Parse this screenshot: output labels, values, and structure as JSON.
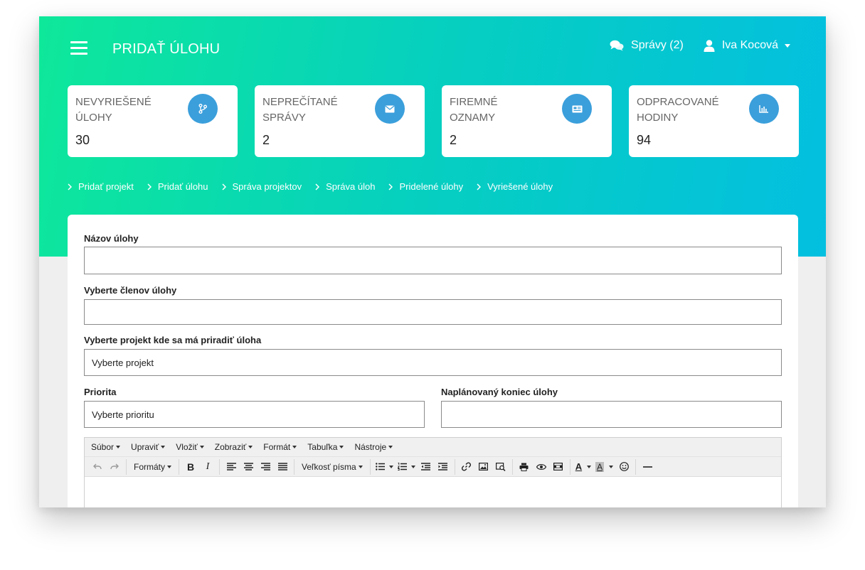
{
  "header": {
    "title": "PRIDAŤ ÚLOHU",
    "messages_label": "Správy (2)",
    "user_name": "Iva Kocová"
  },
  "stats": [
    {
      "label": "NEVYRIEŠENÉ ÚLOHY",
      "value": "30",
      "icon": "branch-icon"
    },
    {
      "label": "NEPREČÍTANÉ SPRÁVY",
      "value": "2",
      "icon": "envelope-icon"
    },
    {
      "label": "FIREMNÉ OZNAMY",
      "value": "2",
      "icon": "newspaper-icon"
    },
    {
      "label": "ODPRACOVANÉ HODINY",
      "value": "94",
      "icon": "bar-chart-icon"
    }
  ],
  "breadcrumbs": [
    "Pridať projekt",
    "Pridať úlohu",
    "Správa projektov",
    "Správa úloh",
    "Pridelené úlohy",
    "Vyriešené úlohy"
  ],
  "form": {
    "task_name_label": "Názov úlohy",
    "task_name_value": "",
    "members_label": "Vyberte členov úlohy",
    "members_value": "",
    "project_label": "Vyberte projekt kde sa má priradiť úloha",
    "project_value": "Vyberte projekt",
    "priority_label": "Priorita",
    "priority_value": "Vyberte prioritu",
    "deadline_label": "Naplánovaný koniec úlohy",
    "deadline_value": ""
  },
  "editor": {
    "menus": [
      "Súbor",
      "Upraviť",
      "Vložiť",
      "Zobraziť",
      "Formát",
      "Tabuľka",
      "Nástroje"
    ],
    "formats_label": "Formáty",
    "fontsize_label": "Veľkosť písma",
    "bold": "B",
    "italic": "I",
    "forecolor": "A",
    "backcolor": "A"
  },
  "colors": {
    "gradient_start": "#0ee89a",
    "gradient_end": "#03bfe0",
    "badge": "#3b9fdb"
  }
}
